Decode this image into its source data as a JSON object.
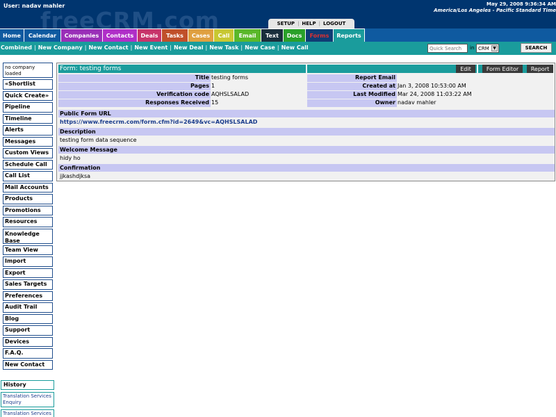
{
  "header": {
    "user": "User: nadav mahler",
    "logo": "freeCRM.com",
    "date": "May 29, 2008 9:36:34 AM",
    "timezone": "America/Los Angeles - Pacific Standard Time",
    "top_links": [
      "SETUP",
      "HELP",
      "LOGOUT"
    ]
  },
  "nav": {
    "tabs": [
      {
        "label": "Home",
        "color": "#0f5aa0"
      },
      {
        "label": "Calendar",
        "color": "#0f5aa0"
      },
      {
        "label": "Companies",
        "color": "#9a2fb8"
      },
      {
        "label": "Contacts",
        "color": "#b02fc8"
      },
      {
        "label": "Deals",
        "color": "#c8346a"
      },
      {
        "label": "Tasks",
        "color": "#c0502a"
      },
      {
        "label": "Cases",
        "color": "#e0a040"
      },
      {
        "label": "Call",
        "color": "#c8c832"
      },
      {
        "label": "Email",
        "color": "#5ab82a"
      },
      {
        "label": "Text",
        "color": "#1a2e3c"
      },
      {
        "label": "Docs",
        "color": "#2aa02a"
      },
      {
        "label": "Forms",
        "color": "#0f3c74",
        "text_color": "#e03030"
      },
      {
        "label": "Reports",
        "color": "#1a9c9c"
      }
    ]
  },
  "subnav": {
    "links": [
      "Combined",
      "New Company",
      "New Contact",
      "New Event",
      "New Deal",
      "New Task",
      "New Case",
      "New Call"
    ],
    "search_placeholder": "Quick Search",
    "in_label": "in",
    "scope_value": "CRM",
    "search_button": "SEARCH"
  },
  "sidebar": {
    "no_company": "no company loaded",
    "items": [
      "«Shortlist",
      "Quick Create»",
      "Pipeline",
      "Timeline",
      "Alerts",
      "Messages",
      "Custom Views",
      "Schedule Call",
      "Call List",
      "Mail Accounts",
      "Products",
      "Promotions",
      "Resources",
      "Knowledge Base",
      "Team View",
      "Import",
      "Export",
      "Sales Targets",
      "Preferences",
      "Audit Trail",
      "Blog",
      "Support",
      "Devices",
      "F.A.Q.",
      "New Contact"
    ],
    "history_label": "History",
    "history_items": [
      "Translation Services Enquiry",
      "Translation Services"
    ]
  },
  "form": {
    "title": "Form: testing forms",
    "buttons": [
      "Edit",
      "Form Editor",
      "Report"
    ],
    "left_fields": [
      {
        "label": "Title",
        "value": "testing forms"
      },
      {
        "label": "Pages",
        "value": "1"
      },
      {
        "label": "Verification code",
        "value": "AQHSLSALAD"
      },
      {
        "label": "Responses Received",
        "value": "15"
      }
    ],
    "right_fields": [
      {
        "label": "Report Email",
        "value": ""
      },
      {
        "label": "Created at",
        "value": "Jan 3, 2008 10:53:00 AM"
      },
      {
        "label": "Last Modified",
        "value": "Mar 24, 2008 11:03:22 AM"
      },
      {
        "label": "Owner",
        "value": "nadav mahler"
      }
    ],
    "sections": [
      {
        "label": "Public Form URL",
        "value": "https://www.freecrm.com/form.cfm?id=2649&vc=AQHSLSALAD"
      },
      {
        "label": "Description",
        "value": "testing form data sequence"
      },
      {
        "label": "Welcome Message",
        "value": "hidy ho"
      },
      {
        "label": "Confirmation",
        "value": "jjkashdjksa"
      }
    ]
  }
}
